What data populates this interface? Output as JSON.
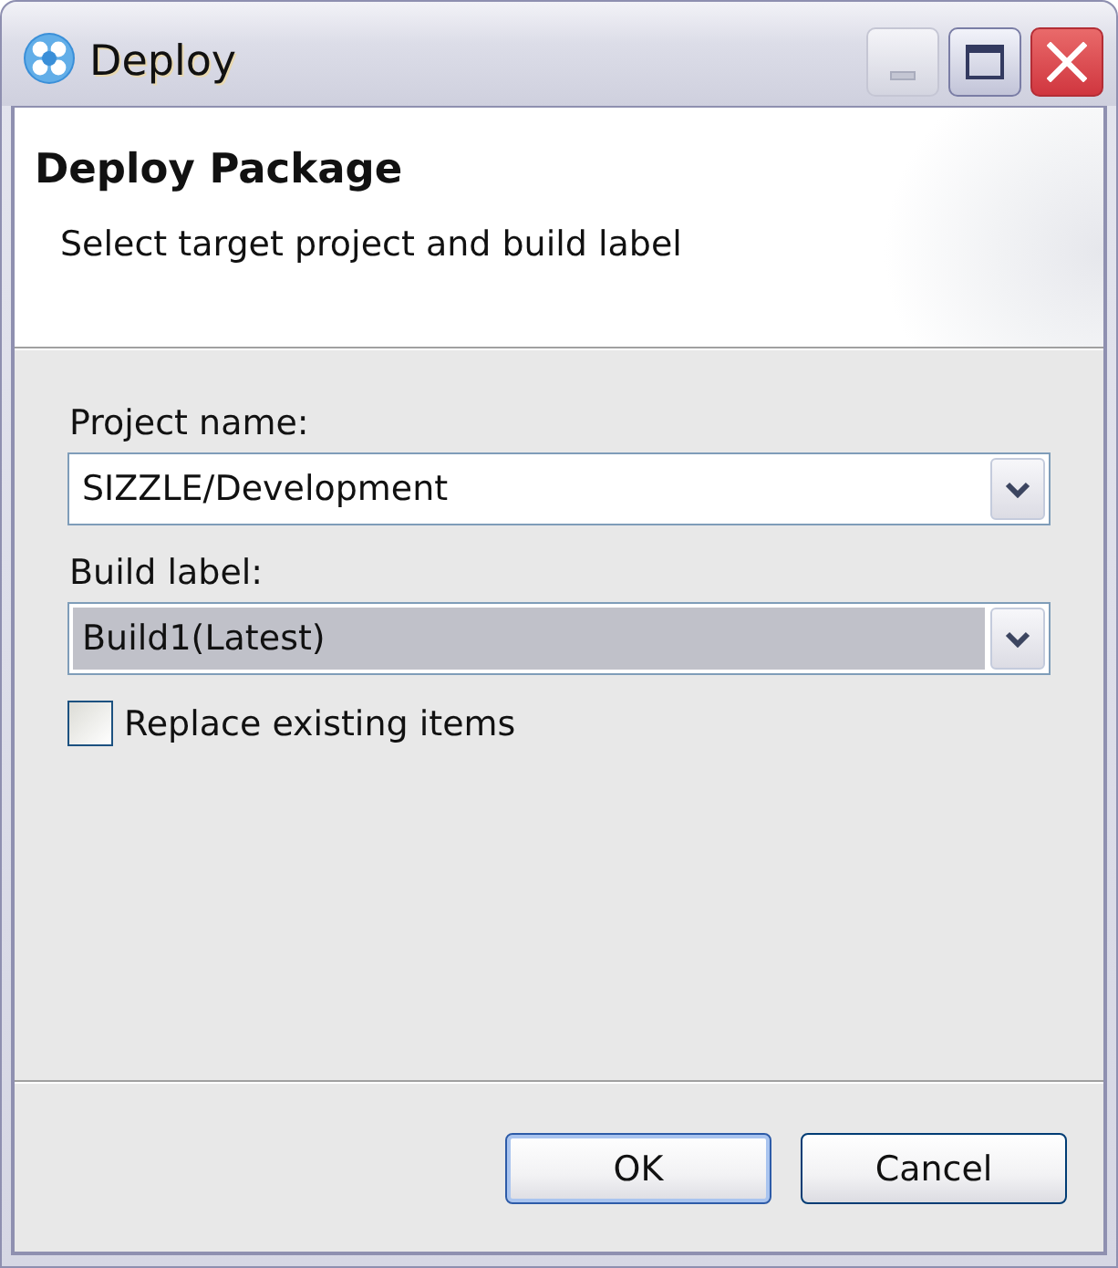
{
  "window": {
    "title": "Deploy"
  },
  "header": {
    "title": "Deploy Package",
    "description": "Select target project and build label"
  },
  "fields": [
    {
      "kind": "combo",
      "label": "Project name:",
      "value": "SIZZLE/Development",
      "highlighted": false
    },
    {
      "kind": "combo",
      "label": "Build label:",
      "value": "Build1(Latest)",
      "highlighted": true
    }
  ],
  "options": [
    {
      "kind": "checkbox",
      "label": "Replace existing items",
      "checked": false
    }
  ],
  "buttons": [
    {
      "label": "OK",
      "default": true
    },
    {
      "label": "Cancel",
      "default": false
    }
  ]
}
